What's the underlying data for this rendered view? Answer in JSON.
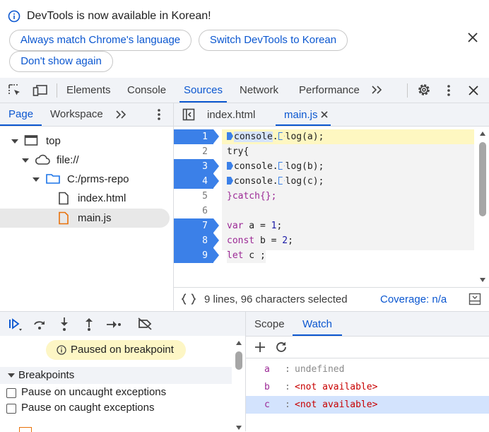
{
  "notification": {
    "message": "DevTools is now available in Korean!",
    "buttons": [
      "Always match Chrome's language",
      "Switch DevTools to Korean",
      "Don't show again"
    ]
  },
  "main_tabs": [
    "Elements",
    "Console",
    "Sources",
    "Network",
    "Performance"
  ],
  "main_tabs_active": "Sources",
  "navigator": {
    "tabs": [
      "Page",
      "Workspace"
    ],
    "active_tab": "Page",
    "tree": [
      {
        "label": "top",
        "icon": "frame-icon"
      },
      {
        "label": "file://",
        "icon": "cloud-icon"
      },
      {
        "label": "C:/prms-repo",
        "icon": "folder-icon"
      },
      {
        "label": "index.html",
        "icon": "file-icon"
      },
      {
        "label": "main.js",
        "icon": "js-file-icon",
        "selected": true
      }
    ]
  },
  "editor": {
    "tabs": [
      "index.html",
      "main.js"
    ],
    "active_tab": "main.js",
    "breakpoint_lines": [
      1,
      3,
      4,
      7,
      8,
      9
    ],
    "line_numbers": [
      "1",
      "2",
      "3",
      "4",
      "5",
      "6",
      "7",
      "8",
      "9"
    ],
    "code": {
      "l1_a": "console",
      "l1_b": ".",
      "l1_c": "log(a);",
      "l2": "try{",
      "l3_a": "console.",
      "l3_b": "log(b);",
      "l4_a": "console.",
      "l4_b": "log(c);",
      "l5": "}catch{};",
      "l7_kw": "var",
      "l7_rest": " a = ",
      "l7_num": "1",
      "l7_end": ";",
      "l8_kw": "const",
      "l8_rest": " b = ",
      "l8_num": "2",
      "l8_end": ";",
      "l9_kw": "let",
      "l9_rest": " c ;"
    },
    "status": {
      "selection": "9 lines, 96 characters selected",
      "coverage": "Coverage: n/a"
    }
  },
  "debugger": {
    "paused_message": "Paused on breakpoint",
    "breakpoints_header": "Breakpoints",
    "options": [
      "Pause on uncaught exceptions",
      "Pause on caught exceptions"
    ]
  },
  "right_pane": {
    "tabs": [
      "Scope",
      "Watch"
    ],
    "active_tab": "Watch",
    "watch": [
      {
        "name": "a",
        "sep": ":",
        "value": "undefined"
      },
      {
        "name": "b",
        "sep": ":",
        "value": "<not available>"
      },
      {
        "name": "c",
        "sep": ":",
        "value": "<not available>",
        "selected": true
      }
    ]
  },
  "colors": {
    "accent": "#0b57d0",
    "breakpoint": "#3b80e8",
    "exec_line": "#fef7c1",
    "paused_badge": "#fdf6c5",
    "selected_row": "#d3e3fd",
    "keyword": "#9c2a96",
    "unavailable": "#c80000"
  }
}
